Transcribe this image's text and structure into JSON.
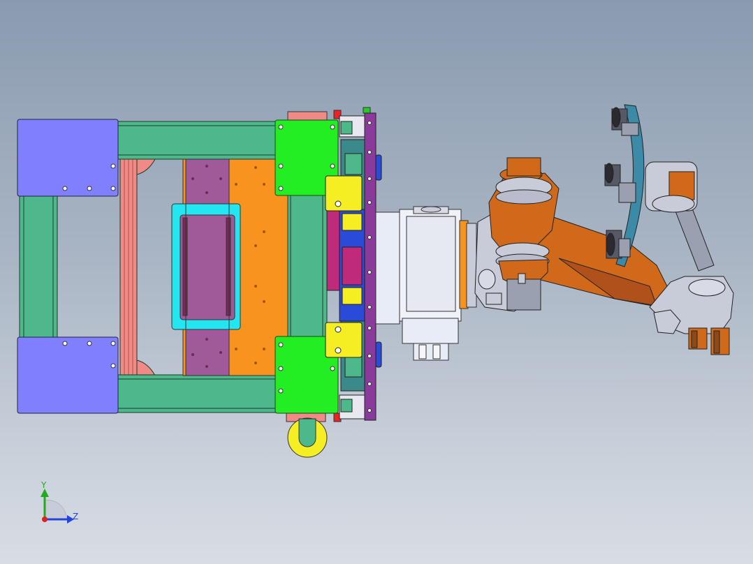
{
  "axis_triad": {
    "y_label": "Y",
    "z_label": "Z",
    "y_color": "#22aa22",
    "z_color": "#2244dd",
    "x_color": "#dd2222"
  },
  "palette": {
    "background_top": "#8a9bb0",
    "background_bottom": "#d8dde4",
    "frame_green": "#4db88a",
    "corner_plate_blue": "#8080ff",
    "bracket_green": "#22ee22",
    "plate_orange": "#f7931e",
    "plate_purple": "#a05a9a",
    "rail_purple": "#8a3a9a",
    "robot_orange": "#d06a1a",
    "robot_grey": "#c8ccd8",
    "gripper_disc": "#3a8aa8",
    "yellow_part": "#f4ee22",
    "cyan_part": "#22e6f0",
    "salmon_part": "#f08a86"
  },
  "icons": [
    "axis-triad-icon"
  ]
}
